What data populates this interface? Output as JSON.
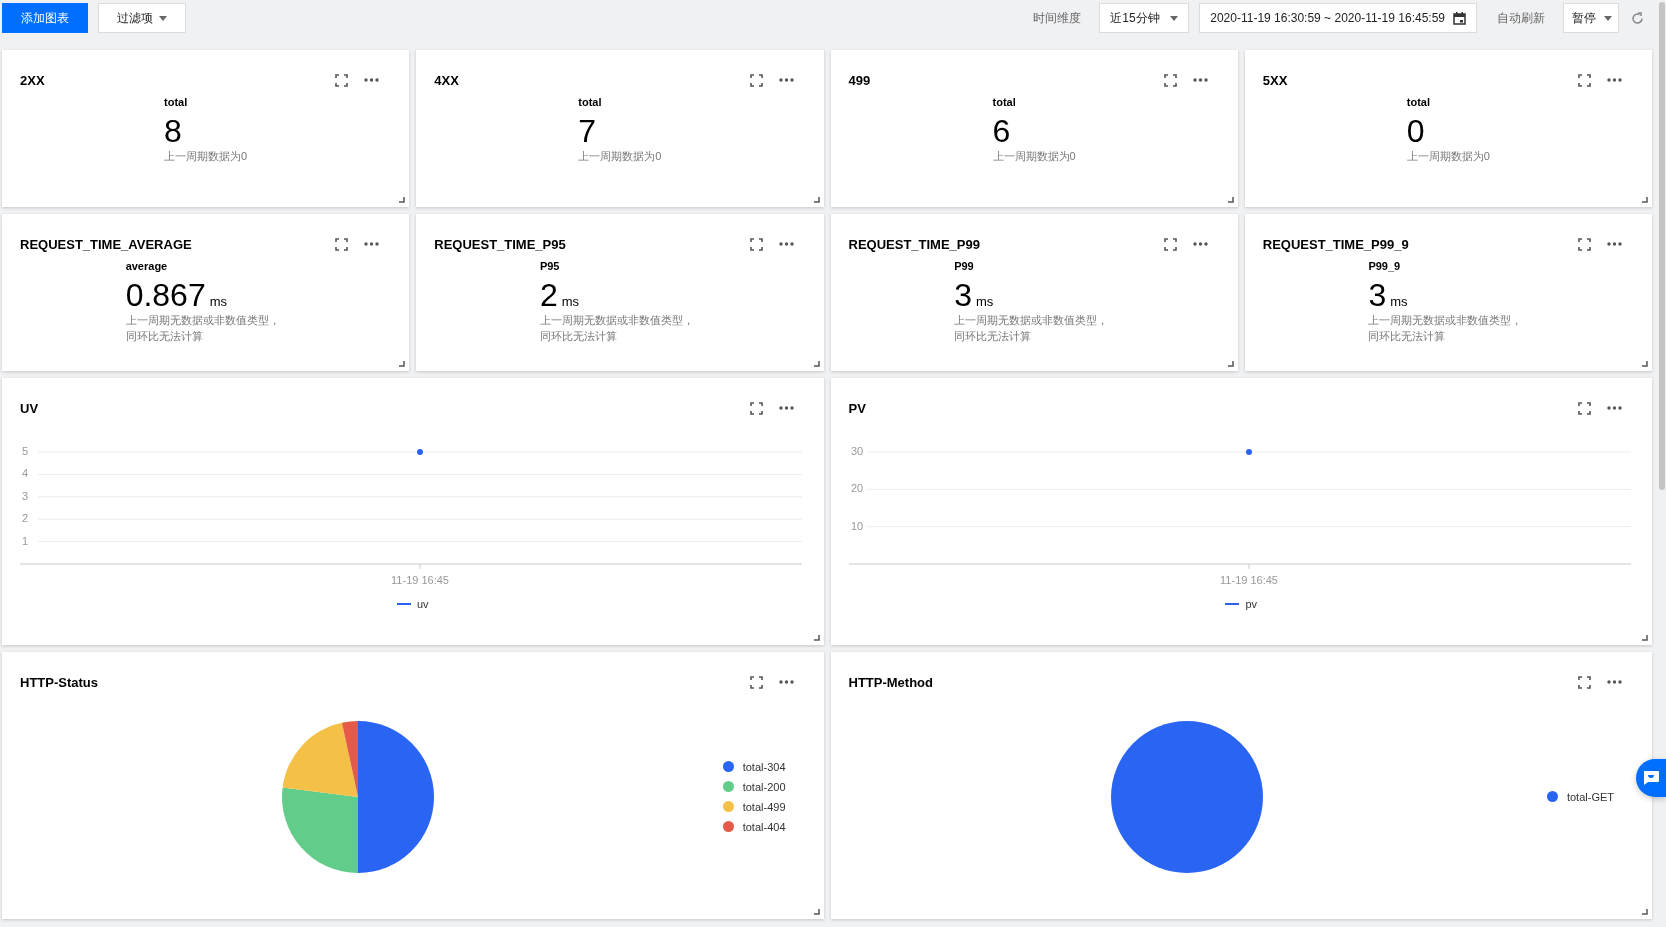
{
  "toolbar": {
    "add_button": "添加图表",
    "filter_button": "过滤项",
    "time_label": "时间维度",
    "time_range": "近15分钟",
    "date_range": "2020-11-19 16:30:59 ~ 2020-11-19 16:45:59",
    "refresh_label": "自动刷新",
    "refresh_mode": "暂停"
  },
  "stat_cards": [
    {
      "title": "2XX",
      "metric": "total",
      "value": "8",
      "compare": "上一周期数据为0"
    },
    {
      "title": "4XX",
      "metric": "total",
      "value": "7",
      "compare": "上一周期数据为0"
    },
    {
      "title": "499",
      "metric": "total",
      "value": "6",
      "compare": "上一周期数据为0"
    },
    {
      "title": "5XX",
      "metric": "total",
      "value": "0",
      "compare": "上一周期数据为0"
    },
    {
      "title": "REQUEST_TIME_AVERAGE",
      "metric": "average",
      "value": "0.867",
      "unit": "ms",
      "compare": "上一周期无数据或非数值类型，同环比无法计算"
    },
    {
      "title": "REQUEST_TIME_P95",
      "metric": "P95",
      "value": "2",
      "unit": "ms",
      "compare": "上一周期无数据或非数值类型，同环比无法计算"
    },
    {
      "title": "REQUEST_TIME_P99",
      "metric": "P99",
      "value": "3",
      "unit": "ms",
      "compare": "上一周期无数据或非数值类型，同环比无法计算"
    },
    {
      "title": "REQUEST_TIME_P99_9",
      "metric": "P99_9",
      "value": "3",
      "unit": "ms",
      "compare": "上一周期无数据或非数值类型，同环比无法计算"
    }
  ],
  "line_cards": [
    {
      "title": "UV",
      "chart_data": {
        "type": "line",
        "grid": true,
        "x": [
          "11-19 16:45"
        ],
        "yticks": [
          1,
          2,
          3,
          4,
          5
        ],
        "ylim": [
          0,
          5
        ],
        "series": [
          {
            "name": "uv",
            "color": "#2a62f0",
            "marker": "circle",
            "values": [
              5
            ]
          }
        ]
      }
    },
    {
      "title": "PV",
      "chart_data": {
        "type": "line",
        "grid": true,
        "x": [
          "11-19 16:45"
        ],
        "yticks": [
          10,
          20,
          30
        ],
        "ylim": [
          0,
          30
        ],
        "series": [
          {
            "name": "pv",
            "color": "#2a62f0",
            "marker": "circle",
            "values": [
              30
            ]
          }
        ]
      }
    }
  ],
  "pie_cards": [
    {
      "title": "HTTP-Status",
      "legend": [
        {
          "label": "total-304",
          "color": "#2964f2"
        },
        {
          "label": "total-200",
          "color": "#62cd8a"
        },
        {
          "label": "total-499",
          "color": "#f4c047"
        },
        {
          "label": "total-404",
          "color": "#e65a48"
        }
      ]
    },
    {
      "title": "HTTP-Method",
      "legend": [
        {
          "label": "total-GET",
          "color": "#2964f2"
        }
      ]
    }
  ]
}
